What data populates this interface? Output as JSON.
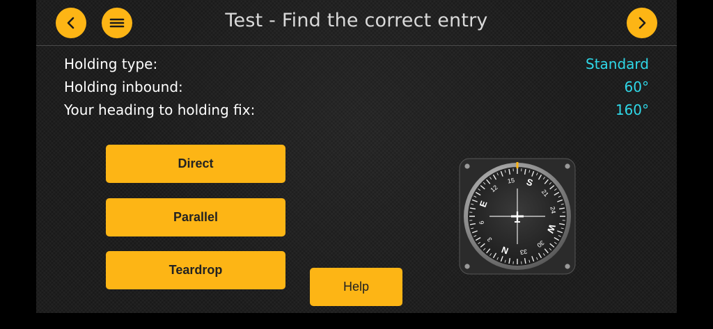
{
  "header": {
    "title": "Test - Find the correct entry",
    "back_icon": "chevron-left-icon",
    "menu_icon": "menu-icon",
    "next_icon": "chevron-right-icon"
  },
  "info": {
    "holding_type_label": "Holding type:",
    "holding_type_value": "Standard",
    "holding_inbound_label": "Holding inbound:",
    "holding_inbound_value": "60°",
    "heading_label": "Your heading to holding fix:",
    "heading_value": "160°"
  },
  "answers": {
    "direct": "Direct",
    "parallel": "Parallel",
    "teardrop": "Teardrop"
  },
  "help_label": "Help",
  "instrument": {
    "heading_deg": 160,
    "card_labels": [
      "N",
      "3",
      "6",
      "E",
      "12",
      "15",
      "S",
      "21",
      "24",
      "W",
      "30",
      "33"
    ]
  },
  "colors": {
    "accent": "#fdb515",
    "value": "#2fd8e8",
    "title": "#d9d9d9"
  }
}
